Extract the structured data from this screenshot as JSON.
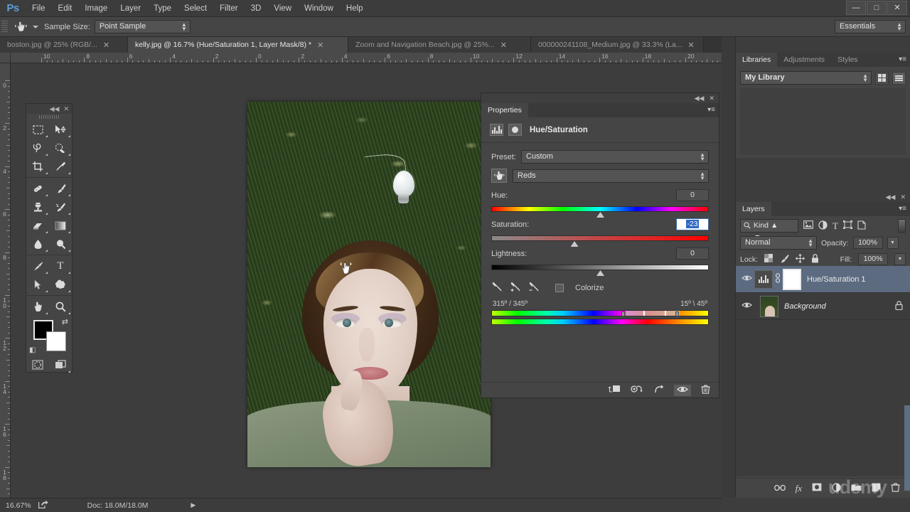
{
  "app": {
    "logo": "Ps",
    "workspace": "Essentials"
  },
  "menubar": {
    "items": [
      "File",
      "Edit",
      "Image",
      "Layer",
      "Type",
      "Select",
      "Filter",
      "3D",
      "View",
      "Window",
      "Help"
    ]
  },
  "window_controls": {
    "minimize": "—",
    "maximize": "□",
    "close": "✕"
  },
  "options_bar": {
    "tool_icon": "hand-targeted-adjustment",
    "sample_size_label": "Sample Size:",
    "sample_size_value": "Point Sample"
  },
  "document_tabs": [
    {
      "title": "boston.jpg @ 25% (RGB/...",
      "active": false,
      "close": "✕"
    },
    {
      "title": "kelly.jpg @ 16.7% (Hue/Saturation 1, Layer Mask/8) *",
      "active": true,
      "close": "✕"
    },
    {
      "title": "Zoom and Navigation Beach.jpg @ 25%...",
      "active": false,
      "close": "✕"
    },
    {
      "title": "000000241108_Medium.jpg @ 33.3% (La...",
      "active": false,
      "close": "✕"
    }
  ],
  "rulers": {
    "horizontal": [
      "10",
      "8",
      "6",
      "4",
      "2",
      "0",
      "2",
      "4",
      "6",
      "8",
      "10",
      "12",
      "14",
      "16",
      "18",
      "20"
    ],
    "vertical": [
      "0",
      "2",
      "4",
      "6",
      "8",
      "10",
      "12",
      "14",
      "16",
      "18"
    ]
  },
  "toolbar": {
    "collapse": "◀◀",
    "close": "✕",
    "tools": [
      {
        "name": "marquee-tool",
        "glyph": "▭"
      },
      {
        "name": "move-tool",
        "glyph": "✥"
      },
      {
        "name": "lasso-tool",
        "glyph": "⌁"
      },
      {
        "name": "quick-selection-tool",
        "glyph": "✧"
      },
      {
        "name": "crop-tool",
        "glyph": "⌗"
      },
      {
        "name": "eyedropper-tool",
        "glyph": "✎"
      },
      {
        "name": "spot-healing-brush-tool",
        "glyph": "❍"
      },
      {
        "name": "brush-tool",
        "glyph": "✐"
      },
      {
        "name": "clone-stamp-tool",
        "glyph": "⎙"
      },
      {
        "name": "history-brush-tool",
        "glyph": "✎"
      },
      {
        "name": "eraser-tool",
        "glyph": "▱"
      },
      {
        "name": "gradient-tool",
        "glyph": "▬"
      },
      {
        "name": "blur-tool",
        "glyph": "💧"
      },
      {
        "name": "dodge-tool",
        "glyph": "🔍"
      },
      {
        "name": "pen-tool",
        "glyph": "✒"
      },
      {
        "name": "type-tool",
        "glyph": "T"
      },
      {
        "name": "path-selection-tool",
        "glyph": "➤"
      },
      {
        "name": "custom-shape-tool",
        "glyph": "✿"
      },
      {
        "name": "hand-tool",
        "glyph": "✋"
      },
      {
        "name": "zoom-tool",
        "glyph": "🔍"
      }
    ],
    "foreground_color": "#000000",
    "background_color": "#ffffff",
    "swap_icon": "⇄",
    "default_icon": "◧",
    "quick_mask_icon": "◌",
    "screen_mode_icon": "❐"
  },
  "properties_panel": {
    "tab_label": "Properties",
    "collapse": "◀◀",
    "close": "✕",
    "menu": "▾≡",
    "title": "Hue/Saturation",
    "preset_label": "Preset:",
    "preset_value": "Custom",
    "channel_value": "Reds",
    "target_adjust_icon": "hand-targeted-adjustment",
    "hue": {
      "label": "Hue:",
      "value": "0",
      "thumb_pct": 50
    },
    "saturation": {
      "label": "Saturation:",
      "value": "-23",
      "thumb_pct": 38,
      "active": true
    },
    "lightness": {
      "label": "Lightness:",
      "value": "0",
      "thumb_pct": 50
    },
    "colorize_label": "Colorize",
    "colorize_checked": false,
    "range_left": "315º / 345º",
    "range_right": "15º \\ 45º",
    "footer_icons": [
      "clip-to-layer-icon",
      "previous-state-icon",
      "reset-icon",
      "visibility-icon",
      "delete-icon"
    ]
  },
  "libraries_panel": {
    "tabs": [
      {
        "label": "Libraries",
        "active": true
      },
      {
        "label": "Adjustments",
        "active": false
      },
      {
        "label": "Styles",
        "active": false
      }
    ],
    "menu": "▾≡",
    "library_value": "My Library",
    "view_grid_icon": "grid-view-icon",
    "view_list_icon": "list-view-icon"
  },
  "layers_panel": {
    "tab_label": "Layers",
    "menu": "▾≡",
    "collapse": "◀◀",
    "close": "✕",
    "filter_kind": "Kind",
    "filter_icons": [
      "image-filter-icon",
      "adjustment-filter-icon",
      "type-filter-icon",
      "shape-filter-icon",
      "smart-object-filter-icon"
    ],
    "blend_mode": "Normal",
    "opacity_label": "Opacity:",
    "opacity_value": "100%",
    "lock_label": "Lock:",
    "lock_icons": [
      "lock-transparent-icon",
      "lock-image-icon",
      "lock-position-icon",
      "lock-all-icon"
    ],
    "fill_label": "Fill:",
    "fill_value": "100%",
    "layers": [
      {
        "name": "Hue/Saturation 1",
        "selected": true,
        "visible": true,
        "italic": false,
        "locked": false,
        "kind": "adjustment"
      },
      {
        "name": "Background",
        "selected": false,
        "visible": true,
        "italic": true,
        "locked": true,
        "kind": "image"
      }
    ],
    "footer_icons": [
      "link-layers-icon",
      "layer-style-icon",
      "layer-mask-icon",
      "adjustment-layer-icon",
      "new-group-icon",
      "new-layer-icon",
      "delete-layer-icon"
    ]
  },
  "status_bar": {
    "zoom": "16.67%",
    "share_icon": "share-icon",
    "doc_info": "Doc: 18.0M/18.0M",
    "arrow": "▶"
  },
  "watermark": "udemy",
  "canvas": {
    "cursor_icon": "hand-cursor",
    "image_description": "woman lying on grass with lightbulb"
  }
}
